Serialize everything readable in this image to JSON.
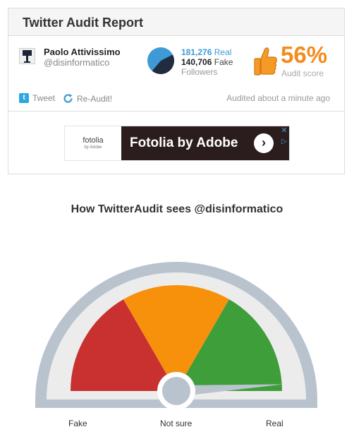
{
  "header": {
    "title": "Twitter Audit Report"
  },
  "user": {
    "name": "Paolo Attivissimo",
    "handle": "@disinformatico"
  },
  "followers": {
    "real_count": "181,276",
    "real_label": "Real",
    "fake_count": "140,706",
    "fake_label": "Fake",
    "label": "Followers",
    "real_fraction": 0.563
  },
  "score": {
    "value": "56%",
    "label": "Audit score"
  },
  "actions": {
    "tweet_label": "Tweet",
    "reaudit_label": "Re-Audit!"
  },
  "audited_text": "Audited about a minute ago",
  "ad": {
    "logo_word": "fotolia",
    "logo_sub": "by Adobe",
    "headline": "Fotolia by Adobe",
    "close_glyph": "✕",
    "choice_glyph": "▷"
  },
  "gauge": {
    "title": "How TwitterAudit sees @disinformatico",
    "labels": {
      "fake": "Fake",
      "not_sure": "Not sure",
      "real": "Real"
    },
    "needle_fraction": 0.98,
    "colors": {
      "fake": "#c93030",
      "not_sure": "#f7900a",
      "real": "#3d9e3a",
      "frame": "#b9c3ce",
      "inner": "#ececec"
    }
  },
  "colors": {
    "accent_blue": "#3e9ad6",
    "score_orange": "#f48b1c",
    "ad_bg": "#2b1d1d"
  }
}
